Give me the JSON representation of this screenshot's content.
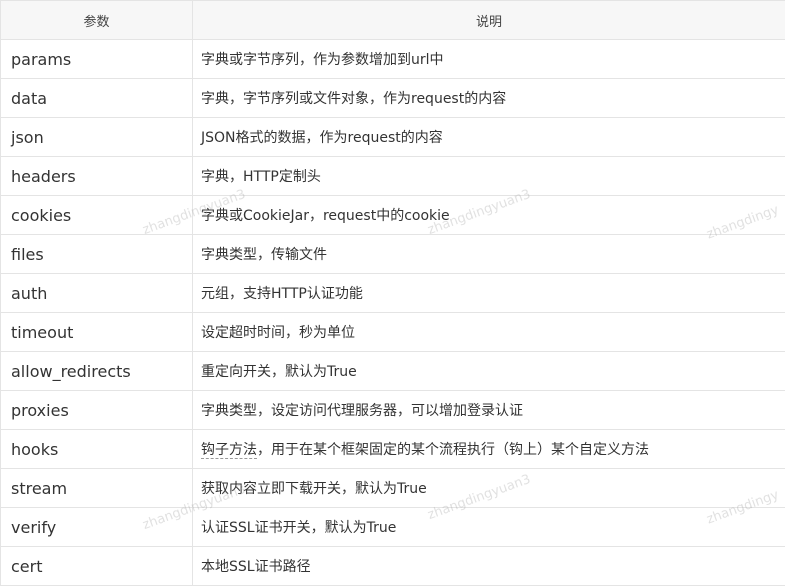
{
  "table": {
    "headers": [
      "参数",
      "说明"
    ],
    "rows": [
      {
        "name": "params",
        "desc": "字典或字节序列，作为参数增加到url中"
      },
      {
        "name": "data",
        "desc": "字典，字节序列或文件对象，作为request的内容"
      },
      {
        "name": "json",
        "desc": "JSON格式的数据，作为request的内容"
      },
      {
        "name": "headers",
        "desc": "字典，HTTP定制头"
      },
      {
        "name": "cookies",
        "desc": "字典或CookieJar，request中的cookie"
      },
      {
        "name": "files",
        "desc": "字典类型，传输文件"
      },
      {
        "name": "auth",
        "desc": "元组，支持HTTP认证功能"
      },
      {
        "name": "timeout",
        "desc": "设定超时时间，秒为单位"
      },
      {
        "name": "allow_redirects",
        "desc": "重定向开关，默认为True"
      },
      {
        "name": "proxies",
        "desc": "字典类型，设定访问代理服务器，可以增加登录认证"
      },
      {
        "name": "hooks",
        "desc_underlined": "钩子方法",
        "desc_rest": "，用于在某个框架固定的某个流程执行（钩上）某个自定义方法"
      },
      {
        "name": "stream",
        "desc": "获取内容立即下载开关，默认为True"
      },
      {
        "name": "verify",
        "desc": "认证SSL证书开关，默认为True"
      },
      {
        "name": "cert",
        "desc": "本地SSL证书路径"
      }
    ]
  },
  "watermark": {
    "text_a": "zhangdingyuan3",
    "text_b": "zhangdingy"
  }
}
